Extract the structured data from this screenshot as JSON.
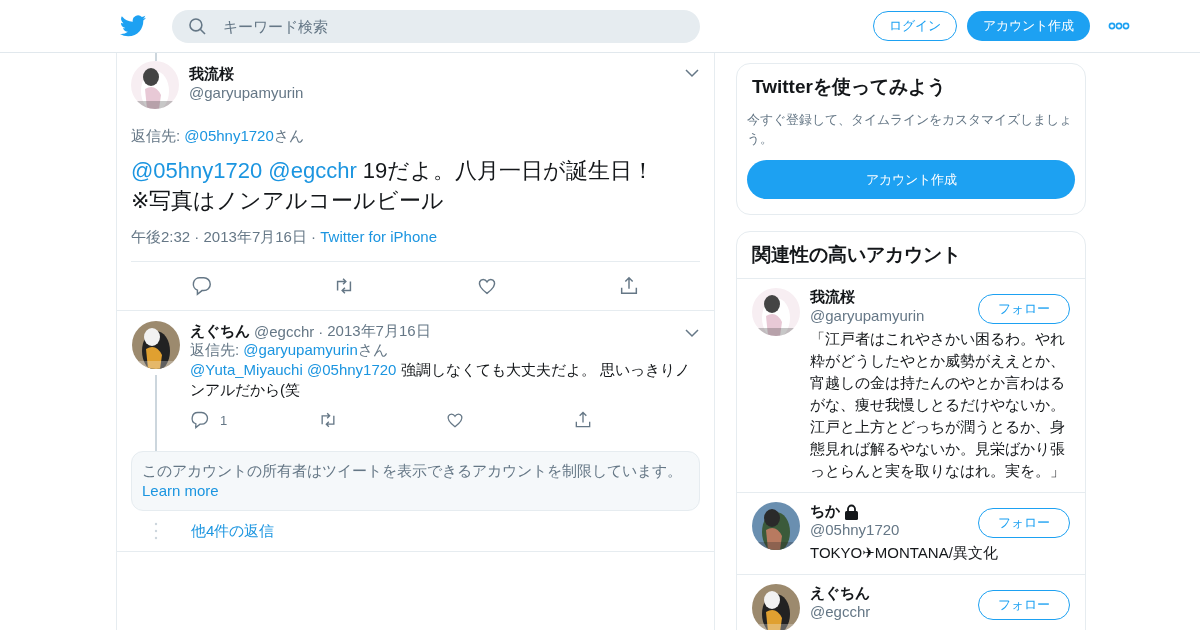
{
  "header": {
    "search": {
      "placeholder": "キーワード検索"
    },
    "login": "ログイン",
    "signup": "アカウント作成"
  },
  "tweet": {
    "name": "我流桜",
    "handle": "@garyupamyurin",
    "reply_to": {
      "prefix": "返信先: ",
      "handle": "@05hny1720",
      "suffix": "さん"
    },
    "mentions": [
      "@05hny1720",
      "@egcchr"
    ],
    "text": "19だよ。八月一日が誕生日！※写真はノンアルコールビール",
    "time": "午後2:32 · 2013年7月16日",
    "separator": "·",
    "source": "Twitter for iPhone",
    "actions": [
      {
        "kind": "reply"
      },
      {
        "kind": "retweet"
      },
      {
        "kind": "like"
      },
      {
        "kind": "share"
      }
    ]
  },
  "reply": {
    "name": "えぐちん",
    "handle": "@egcchr",
    "separator": "·",
    "date": "2013年7月16日",
    "reply_to": {
      "prefix": "返信先: ",
      "handle": "@garyupamyurin",
      "suffix": "さん"
    },
    "mentions": [
      "@Yuta_Miyauchi",
      "@05hny1720"
    ],
    "text": "強調しなくても大丈夫だよ。 思いっきりノンアルだから(笑",
    "actions": [
      {
        "kind": "reply",
        "count": "1"
      },
      {
        "kind": "retweet"
      },
      {
        "kind": "like"
      },
      {
        "kind": "share"
      }
    ]
  },
  "notice": {
    "text": "このアカウントの所有者はツイートを表示できるアカウントを制限しています。",
    "link": "Learn more"
  },
  "more_replies": "他4件の返信",
  "signup_card": {
    "title": "Twitterを使ってみよう",
    "subtitle": "今すぐ登録して、タイムラインをカスタマイズしましょう。",
    "button": "アカウント作成"
  },
  "related": {
    "title": "関連性の高いアカウント",
    "accounts": [
      {
        "name": "我流桜",
        "handle": "@garyupamyurin",
        "protected": false,
        "follow": "フォロー",
        "bio": "「江戸者はこれやさかい困るわ。やれ粋がどうしたやとか威勢がええとか、宵越しの金は持たんのやとか言わはるがな、痩せ我慢しとるだけやないか。江戸と上方とどっちが潤うとるか、身態見れば解るやないか。見栄ばかり張っとらんと実を取りなはれ。実を。」"
      },
      {
        "name": "ちか",
        "handle": "@05hny1720",
        "protected": true,
        "follow": "フォロー",
        "bio": "TOKYO✈MONTANA/異文化"
      },
      {
        "name": "えぐちん",
        "handle": "@egcchr",
        "protected": false,
        "follow": "フォロー"
      }
    ]
  }
}
